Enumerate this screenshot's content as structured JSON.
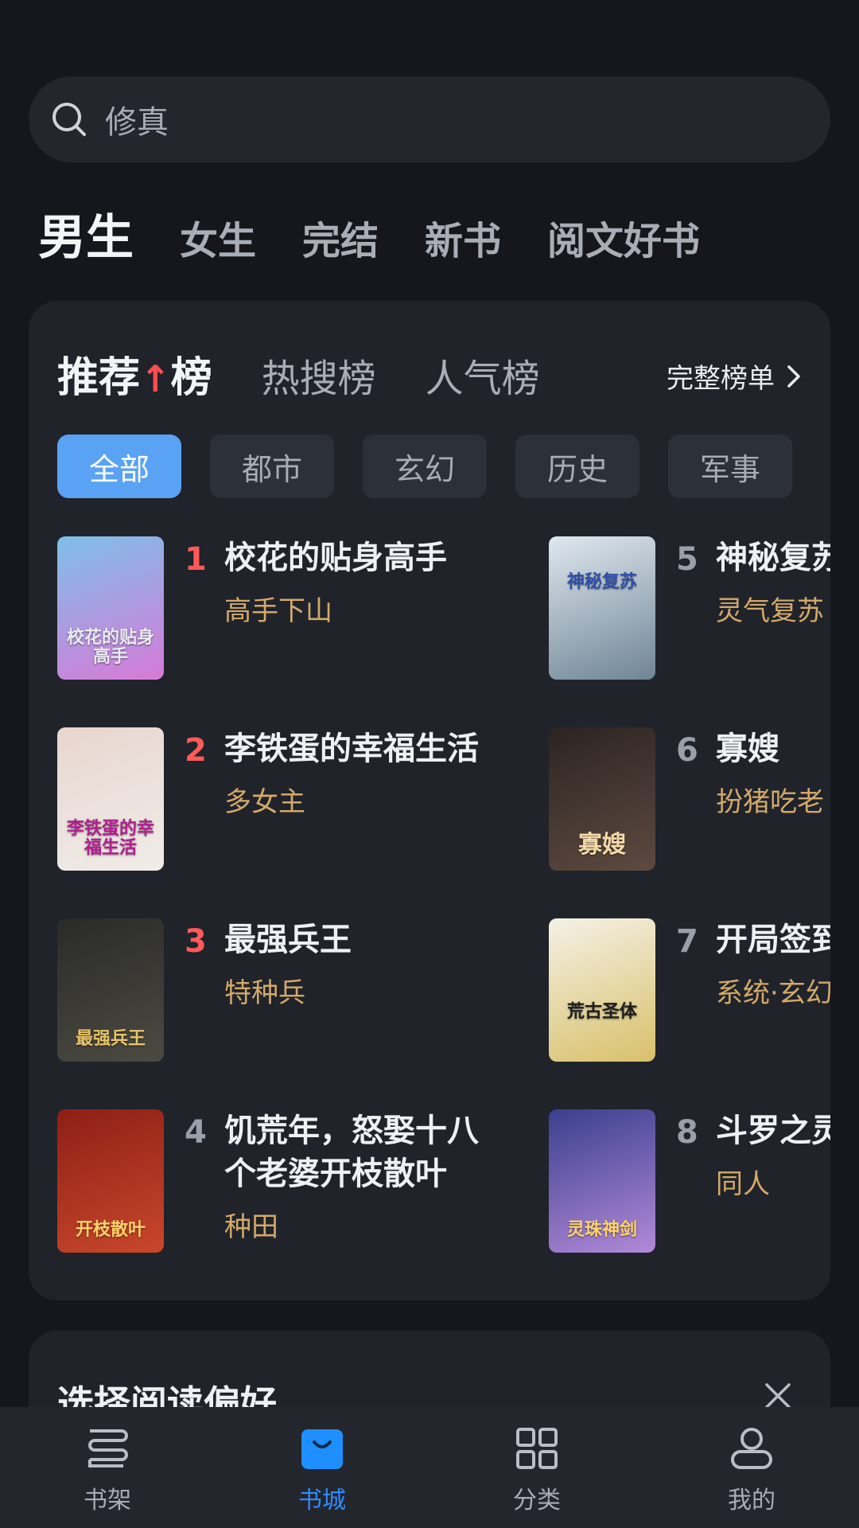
{
  "search": {
    "query": "修真"
  },
  "top_tabs": [
    {
      "label": "男生",
      "active": true
    },
    {
      "label": "女生"
    },
    {
      "label": "完结"
    },
    {
      "label": "新书"
    },
    {
      "label": "阅文好书"
    }
  ],
  "rank": {
    "tabs": [
      {
        "label": "推荐榜",
        "active": true
      },
      {
        "label": "热搜榜"
      },
      {
        "label": "人气榜"
      }
    ],
    "full_list_label": "完整榜单",
    "chips": [
      {
        "label": "全部",
        "active": true
      },
      {
        "label": "都市"
      },
      {
        "label": "玄幻"
      },
      {
        "label": "历史"
      },
      {
        "label": "军事"
      }
    ],
    "books": [
      {
        "rank": "1",
        "title": "校花的贴身高手",
        "tag": "高手下山",
        "cover_text": "校花的贴身高手",
        "colors": [
          "#7fbfe8",
          "#d77ad8"
        ]
      },
      {
        "rank": "2",
        "title": "李铁蛋的幸福生活",
        "tag": "多女主",
        "cover_text": "李铁蛋的幸福生活",
        "colors": [
          "#e8d6cf",
          "#f0ece8"
        ]
      },
      {
        "rank": "3",
        "title": "最强兵王",
        "tag": "特种兵",
        "cover_text": "最强兵王",
        "colors": [
          "#2a2a28",
          "#4b4a42"
        ]
      },
      {
        "rank": "4",
        "title": "饥荒年，怒娶十八个老婆开枝散叶",
        "tag": "种田",
        "cover_text": "开枝散叶",
        "colors": [
          "#8d1f16",
          "#c9472b"
        ]
      },
      {
        "rank": "5",
        "title": "神秘复苏",
        "tag": "灵气复苏",
        "cover_text": "神秘复苏",
        "colors": [
          "#dfe7ee",
          "#6f8596"
        ]
      },
      {
        "rank": "6",
        "title": "寡嫂",
        "tag": "扮猪吃老",
        "cover_text": "寡嫂",
        "colors": [
          "#2c2422",
          "#5d4a40"
        ]
      },
      {
        "rank": "7",
        "title": "开局签到",
        "tag": "系统·玄幻",
        "cover_text": "荒古圣体",
        "colors": [
          "#f4f1e6",
          "#d9c06a"
        ]
      },
      {
        "rank": "8",
        "title": "斗罗之灵",
        "tag": "同人",
        "cover_text": "灵珠神剑",
        "colors": [
          "#3a3f8e",
          "#b28ad8"
        ]
      }
    ]
  },
  "preference": {
    "title": "选择阅读偏好"
  },
  "bottom_nav": [
    {
      "label": "书架",
      "icon": "bookshelf-icon"
    },
    {
      "label": "书城",
      "icon": "bookstore-bag-icon",
      "active": true
    },
    {
      "label": "分类",
      "icon": "grid-icon"
    },
    {
      "label": "我的",
      "icon": "profile-icon"
    }
  ],
  "colors": {
    "background": "#15171c",
    "card": "#20232a",
    "accent_blue": "#5aa2f4",
    "rank_hot": "#ff5a5a",
    "tag_gold": "#d3a96a",
    "nav_active": "#2e8bff"
  }
}
